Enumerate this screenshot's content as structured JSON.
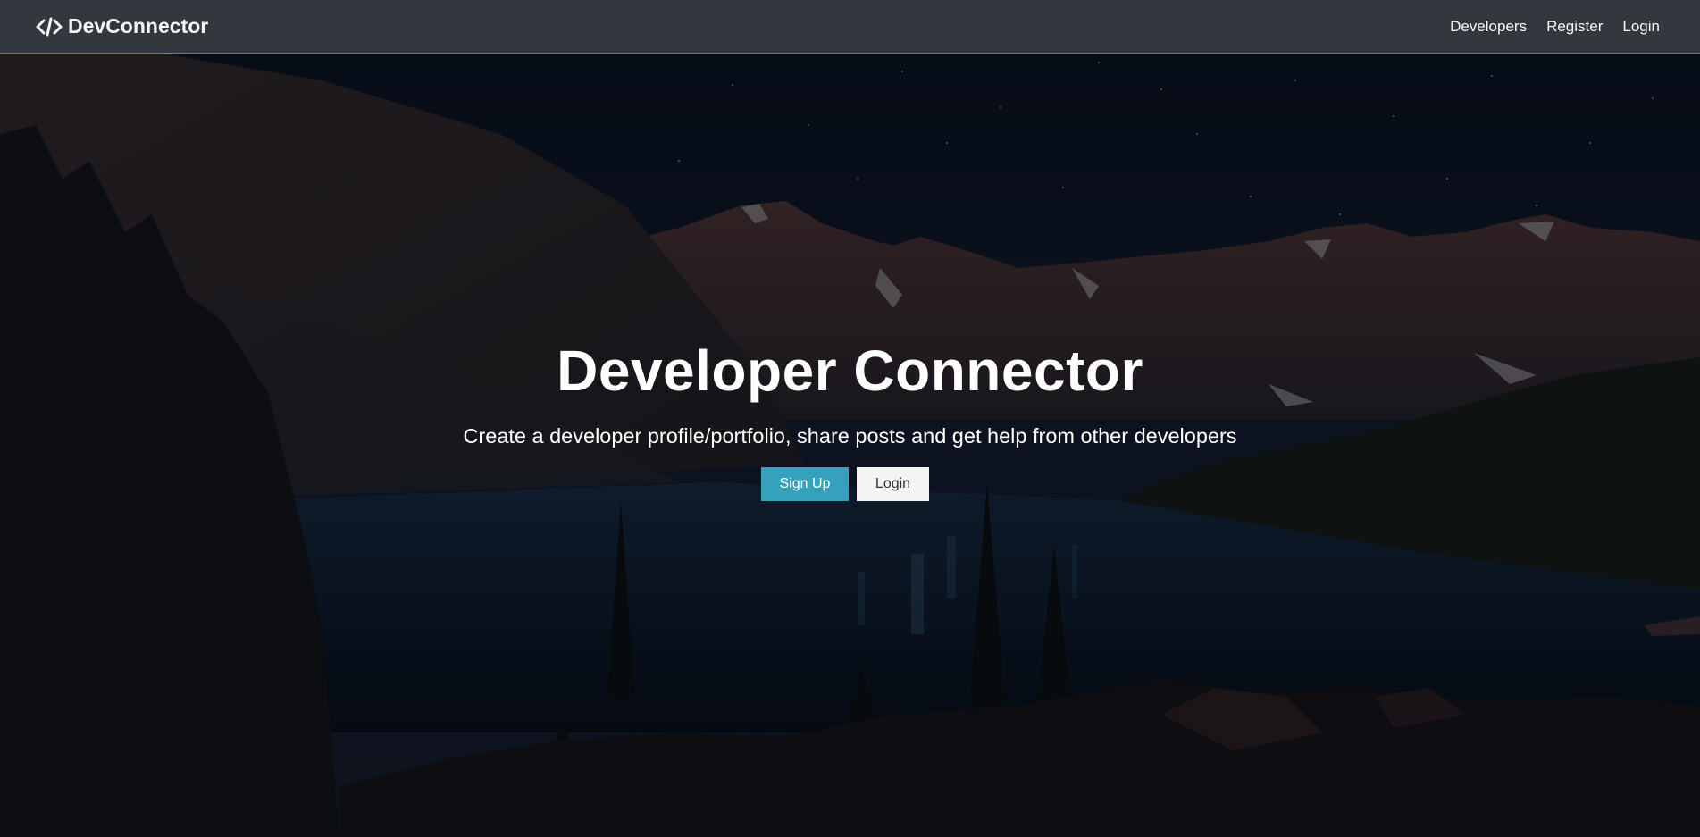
{
  "navbar": {
    "brand_text": "DevConnector",
    "brand_icon": "code-icon",
    "links": [
      {
        "label": "Developers"
      },
      {
        "label": "Register"
      },
      {
        "label": "Login"
      }
    ],
    "accent_color": "#17a2b8"
  },
  "hero": {
    "title": "Developer Connector",
    "lead": "Create a developer profile/portfolio, share posts and get help from other developers",
    "buttons": {
      "signup_label": "Sign Up",
      "login_label": "Login"
    },
    "background": "mountain-lake-night-photo"
  },
  "colors": {
    "primary": "#35a1bd",
    "light": "#f4f4f4",
    "dark": "#343a40"
  }
}
